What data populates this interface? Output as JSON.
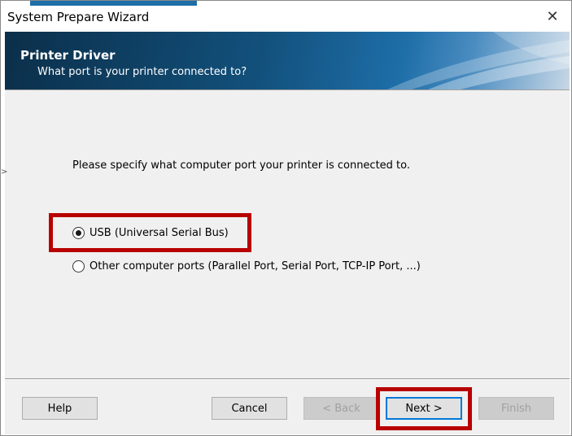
{
  "window": {
    "title": "System Prepare Wizard",
    "close_symbol": "✕"
  },
  "banner": {
    "title": "Printer Driver",
    "subtitle": "What port is your printer connected to?"
  },
  "main": {
    "prompt": "Please specify what computer port your printer is connected to.",
    "options": [
      {
        "label": "USB (Universal Serial Bus)",
        "selected": true,
        "highlighted": true
      },
      {
        "label": "Other computer ports (Parallel Port, Serial Port, TCP-IP Port, ...)",
        "selected": false,
        "highlighted": false
      }
    ]
  },
  "footer": {
    "help_label": "Help",
    "cancel_label": "Cancel",
    "back_label": "< Back",
    "next_label": "Next >",
    "finish_label": "Finish"
  },
  "colors": {
    "highlight": "#b80000",
    "banner_dark": "#0b2f4a",
    "banner_light": "#1e6ea8",
    "focus": "#0078d7"
  }
}
